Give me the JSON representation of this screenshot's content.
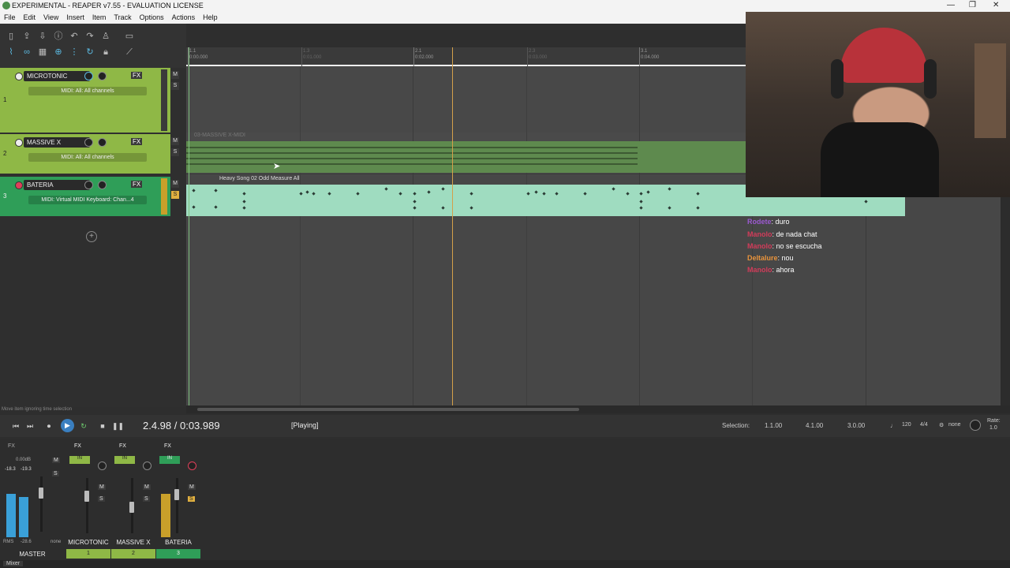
{
  "window": {
    "title": "EXPERIMENTAL - REAPER v7.55 - EVALUATION LICENSE",
    "minimize_glyph": "—",
    "maximize_glyph": "❐",
    "close_glyph": "✕"
  },
  "menu": [
    "File",
    "Edit",
    "View",
    "Insert",
    "Item",
    "Track",
    "Options",
    "Actions",
    "Help"
  ],
  "ruler": {
    "marks": [
      {
        "bar": "1.1",
        "time": "0:00.000"
      },
      {
        "bar": "1.3",
        "time": "0:01.000"
      },
      {
        "bar": "2.1",
        "time": "0:02.000"
      },
      {
        "bar": "2.3",
        "time": "0:03.000"
      },
      {
        "bar": "3.1",
        "time": "0:04.000"
      }
    ]
  },
  "tracks": [
    {
      "index": "1",
      "name": "MICROTONIC",
      "fx": "FX",
      "routing": "MIDI: All: All channels",
      "fx_small": "FX",
      "color": "#8fb846"
    },
    {
      "index": "2",
      "name": "MASSIVE X",
      "fx": "FX",
      "routing": "MIDI: All: All channels",
      "fx_small": "FX",
      "color": "#8fb846"
    },
    {
      "index": "3",
      "name": "BATERIA",
      "fx": "FX",
      "routing": "MIDI: Virtual MIDI Keyboard: Chan...4",
      "fx_small": "FX",
      "color": "#2f9e58"
    }
  ],
  "track_buttons": {
    "mute": "M",
    "solo": "S"
  },
  "items": {
    "massive": "03-MASSIVE X-MIDI",
    "bateria": "Heavy Song 02 Odd Measure All"
  },
  "status_hint": "Move item ignoring time selection",
  "transport": {
    "position": "2.4.98 / 0:03.989",
    "state": "[Playing]",
    "selection_label": "Selection:",
    "selection_start": "1.1.00",
    "selection_end": "4.1.00",
    "selection_length": "3.0.00",
    "bpm": "120",
    "time_sig": "4/4",
    "sync": "none",
    "rate_label": "Rate:",
    "rate_value": "1.0"
  },
  "mixer": {
    "master": {
      "label": "MASTER",
      "fx": "FX",
      "peak_l": "-18.3",
      "peak_r": "-19.3",
      "db": "0.00dB",
      "rms_label": "RMS",
      "rms_value": "-28.6",
      "route": "none"
    },
    "strips": [
      {
        "name": "MICROTONIC",
        "num": "1",
        "fx": "FX",
        "in": "IN",
        "color": "#8fb846"
      },
      {
        "name": "MASSIVE X",
        "num": "2",
        "fx": "FX",
        "in": "IN",
        "color": "#8fb846"
      },
      {
        "name": "BATERIA",
        "num": "3",
        "fx": "FX",
        "in": "IN",
        "color": "#2f9e58"
      }
    ],
    "tab": "Mixer"
  },
  "chat": [
    {
      "user": "Rodete",
      "text": ": duro",
      "style": "p"
    },
    {
      "user": "Manolo",
      "text": ": de nada chat",
      "style": "r"
    },
    {
      "user": "Manolo",
      "text": ": no se escucha",
      "style": "r"
    },
    {
      "user": "Deltalure",
      "text": ": nou",
      "style": "o"
    },
    {
      "user": "Manolo",
      "text": ": ahora",
      "style": "r"
    }
  ]
}
